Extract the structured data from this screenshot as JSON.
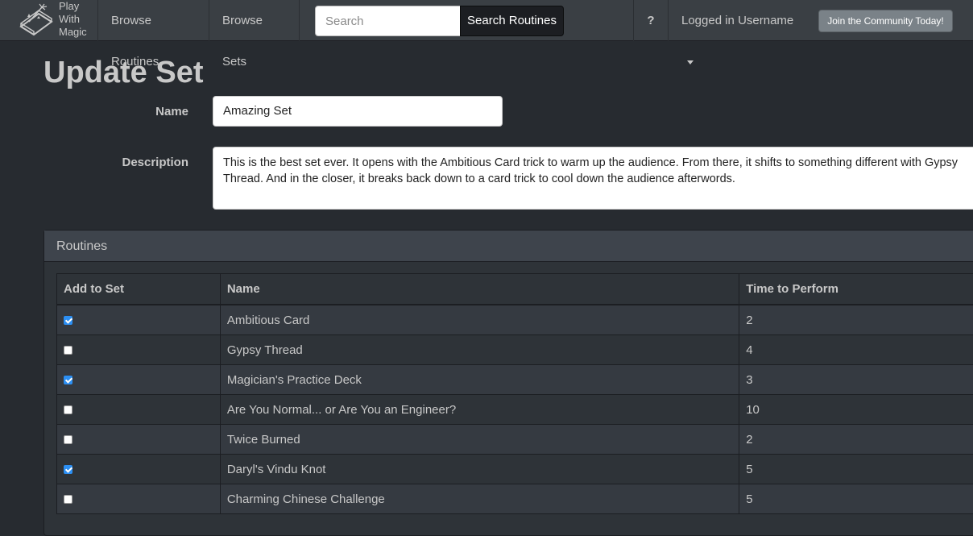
{
  "navbar": {
    "brand_lines": [
      "Play",
      "With",
      "Magic"
    ],
    "browse_routines": "Browse Routines",
    "browse_sets": "Browse Sets",
    "search_placeholder": "Search",
    "search_button": "Search Routines",
    "help": "?",
    "user_menu": "Logged in Username",
    "join_button": "Join the Community Today!"
  },
  "form": {
    "title": "Update Set",
    "name_label": "Name",
    "name_value": "Amazing Set",
    "description_label": "Description",
    "description_value": "This is the best set ever. It opens with the Ambitious Card trick to warm up the audience. From there, it shifts to something different with Gypsy Thread. And in the closer, it breaks back down to a card trick to cool down the audience afterwords."
  },
  "routines_panel": {
    "heading": "Routines",
    "columns": [
      "Add to Set",
      "Name",
      "Time to Perform"
    ],
    "rows": [
      {
        "checked": true,
        "name": "Ambitious Card",
        "time": "2"
      },
      {
        "checked": false,
        "name": "Gypsy Thread",
        "time": "4"
      },
      {
        "checked": true,
        "name": "Magician's Practice Deck",
        "time": "3"
      },
      {
        "checked": false,
        "name": "Are You Normal... or Are You an Engineer?",
        "time": "10"
      },
      {
        "checked": false,
        "name": "Twice Burned",
        "time": "2"
      },
      {
        "checked": true,
        "name": "Daryl's Vindu Knot",
        "time": "5"
      },
      {
        "checked": false,
        "name": "Charming Chinese Challenge",
        "time": "5"
      }
    ]
  },
  "colors": {
    "background": "#272b30",
    "navbar": "#3a3f44",
    "checkbox_checked": "#2c8ff3",
    "join_button": "#7a8288"
  }
}
